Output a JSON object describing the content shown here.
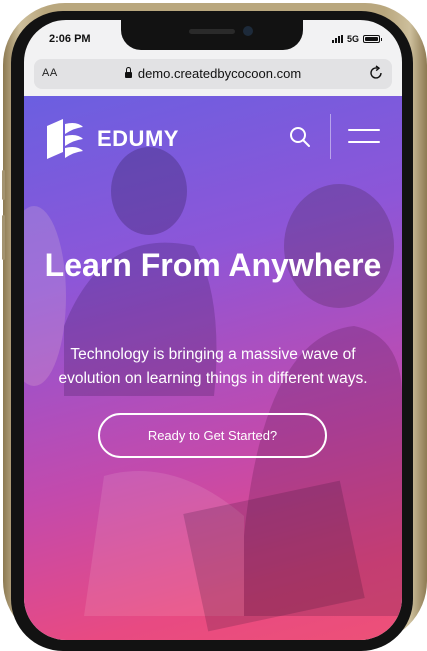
{
  "status_bar": {
    "time": "2:06 PM",
    "network": "5G"
  },
  "browser": {
    "text_size_label": "AA",
    "url": "demo.createdbycocoon.com"
  },
  "site": {
    "brand": "EDUMY",
    "hero_title": "Learn From Anywhere",
    "hero_subtitle": "Technology is bringing a massive wave of evolution on learning things in different ways.",
    "cta_label": "Ready to Get Started?"
  },
  "colors": {
    "gradient_top": "#6b5fe0",
    "gradient_bottom": "#ee5275",
    "phone_frame": "#b9a77e"
  },
  "icons": [
    "lock-icon",
    "reload-icon",
    "logo-icon",
    "search-icon",
    "menu-icon",
    "signal-icon",
    "battery-icon"
  ]
}
